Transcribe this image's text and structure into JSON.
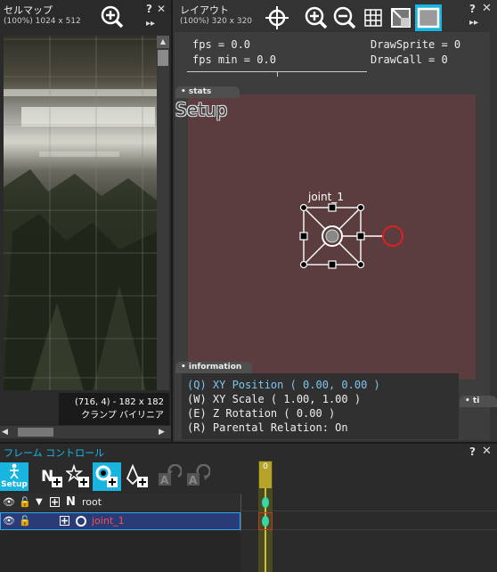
{
  "cellmap": {
    "title": "セルマップ",
    "subtitle": "(100%) 1024 x 512",
    "help": "?",
    "close": "✕",
    "forward": "▸▸",
    "info_line1": "(716, 4) - 182 x 182",
    "info_line2": "クランプ バイリニア"
  },
  "layout": {
    "title": "レイアウト",
    "subtitle": "(100%) 320 x 320",
    "help": "?",
    "close": "✕",
    "forward": "▸▸",
    "stats": {
      "fps": "fps = 0.0",
      "fps_min": "fps min = 0.0",
      "draw_sprite": "DrawSprite = 0",
      "draw_call": "DrawCall = 0"
    },
    "tab_stats": "• stats",
    "setup_label": "Setup",
    "tab_information": "• information",
    "tab_ti": "• ti",
    "info_lines": [
      "(Q) XY Position ( 0.00, 0.00 )",
      "(W) XY Scale ( 1.00, 1.00 )",
      "(E) Z Rotation ( 0.00 )",
      "(R) Parental Relation: On"
    ],
    "joint_label": "joint_1"
  },
  "frame_control": {
    "title": "フレーム コントロール",
    "help": "?",
    "close": "✕",
    "setup_button": "Setup",
    "timeline_frame": "0",
    "rows": [
      {
        "name": "root"
      },
      {
        "name": "joint_1"
      }
    ]
  },
  "colors": {
    "accent": "#18b5e0",
    "stage": "#5c3d3f",
    "selected_row": "#2a3c78",
    "joint_text": "#ff4d4d",
    "timeline": "#b6a42a",
    "key": "#39d6a6",
    "handle_red": "#e02020"
  }
}
